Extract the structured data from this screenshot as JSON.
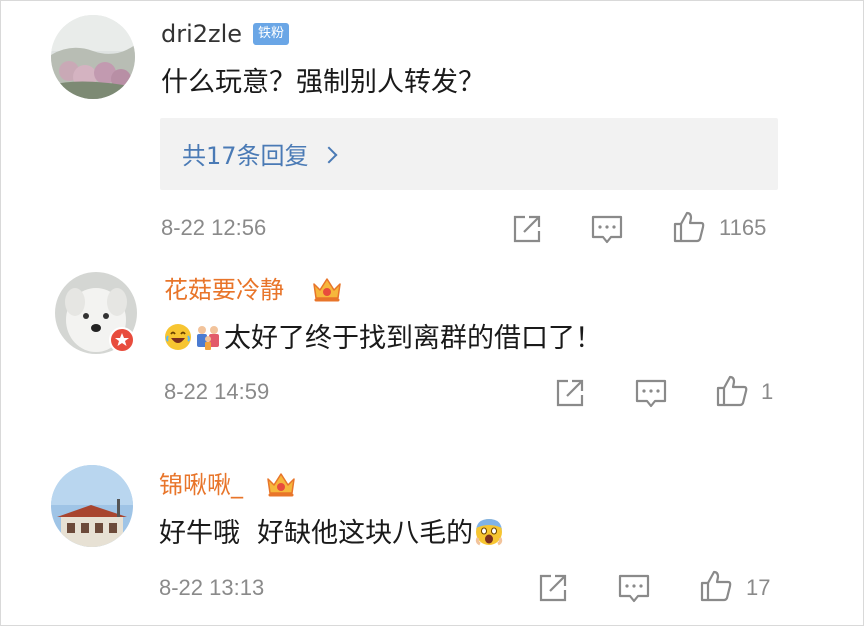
{
  "comments": [
    {
      "username": "dri2zle",
      "fan_badge": "铁粉",
      "text": "什么玩意？强制别人转发？",
      "replies_label": "共17条回复",
      "time": "8-22 12:56",
      "likes": "1165",
      "avatar_icon": "landscape-avatar"
    },
    {
      "username": "花菇要冷静",
      "emoji_icons": [
        "laughing-emoji",
        "family-emoji"
      ],
      "text": "太好了终于找到离群的借口了！",
      "time": "8-22 14:59",
      "likes": "1",
      "avatar_icon": "dog-avatar",
      "avatar_badge_icon": "verified-star-badge"
    },
    {
      "username": "锦啾啾_",
      "text": "好牛哦  好缺他这块八毛的",
      "trailing_emoji_icon": "scared-emoji",
      "time": "8-22 13:13",
      "likes": "17",
      "avatar_icon": "building-avatar"
    }
  ],
  "colors": {
    "accent_link": "#4a7ab5",
    "vip_name": "#e8752a",
    "fan_badge": "#6aa6e6",
    "meta": "#8a8a8a"
  }
}
